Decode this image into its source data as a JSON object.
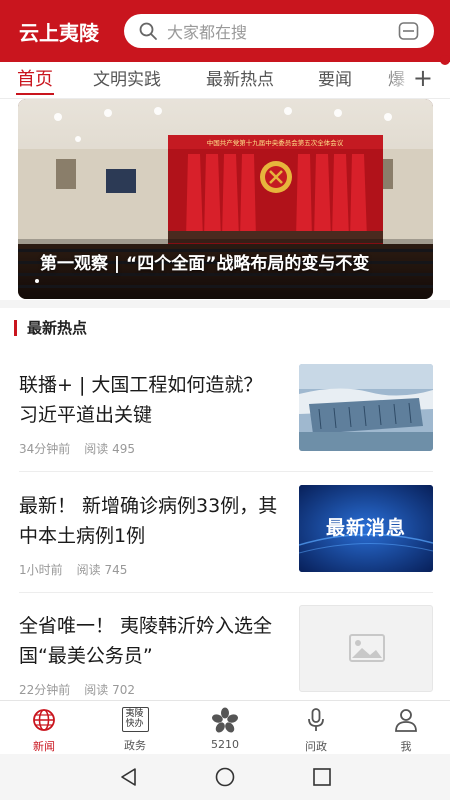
{
  "header": {
    "app_title": "云上夷陵",
    "search_placeholder": "大家都在搜"
  },
  "tabs": [
    {
      "label": "首页",
      "active": true
    },
    {
      "label": "文明实践",
      "active": false
    },
    {
      "label": "最新热点",
      "active": false
    },
    {
      "label": "要闻",
      "active": false
    },
    {
      "label": "爆",
      "active": false
    }
  ],
  "banner": {
    "caption": "第一观察 | “四个全面”战略布局的变与不变",
    "hall_banner_text": "中国共产党第十九届中央委员会第五次全体会议"
  },
  "section": {
    "title": "最新热点"
  },
  "news": [
    {
      "title": "联播+ | 大国工程如何造就？习近平道出关键",
      "time": "34分钟前",
      "reads": "阅读 495",
      "thumb": "dam-photo"
    },
    {
      "title": "最新！ 新增确诊病例33例，其中本土病例1例",
      "time": "1小时前",
      "reads": "阅读 745",
      "thumb": "breaking-news",
      "thumb_text": "最新消息"
    },
    {
      "title": "全省唯一！ 夷陵韩沂妗入选全国“最美公务员”",
      "time": "22分钟前",
      "reads": "阅读 702",
      "thumb": "placeholder-image"
    }
  ],
  "bottom_nav": [
    {
      "label": "新闻",
      "icon": "globe-icon",
      "active": true
    },
    {
      "label": "政务",
      "icon": "yiling-express-icon",
      "active": false,
      "icon_text": "夷陵快办"
    },
    {
      "label": "5210",
      "icon": "flower-icon",
      "active": false
    },
    {
      "label": "问政",
      "icon": "microphone-icon",
      "active": false
    },
    {
      "label": "我",
      "icon": "user-icon",
      "active": false
    }
  ],
  "colors": {
    "brand_red": "#c9151e",
    "accent_blue": "#1a4fa0"
  }
}
